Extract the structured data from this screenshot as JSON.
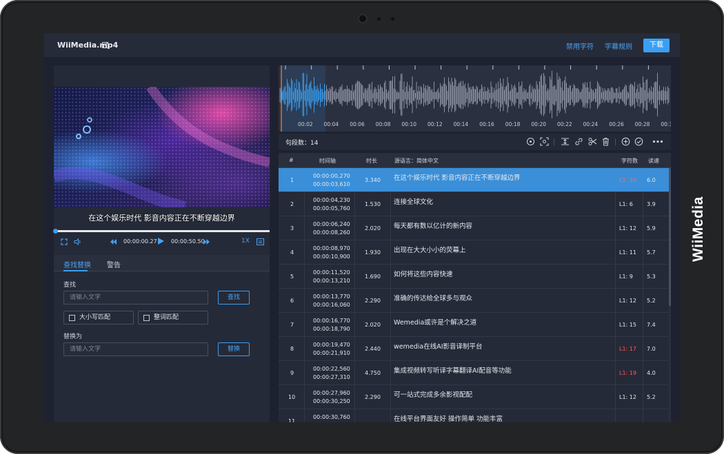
{
  "device": {
    "brand": "WiiMedia"
  },
  "header": {
    "file_name": "WiiMedia.mp4",
    "forbidden_chars_label": "禁用字符",
    "subtitle_rules_label": "字幕规则",
    "download_label": "下载"
  },
  "player": {
    "subtitle": "在这个娱乐时代 影音内容正在不断穿越边界",
    "current_time": "00:00:00.27",
    "total_time": "00:00:50.50",
    "speed": "1X",
    "progress": 0.005
  },
  "find_replace": {
    "tab_find_replace": "查找替换",
    "tab_warning": "警告",
    "find_label": "查找",
    "find_placeholder": "请输入文字",
    "find_button": "查找",
    "match_case_label": "大小写匹配",
    "whole_word_label": "整词匹配",
    "replace_label": "替换为",
    "replace_placeholder": "请输入文字",
    "replace_button": "替换"
  },
  "waveform": {
    "time_labels": [
      "00:02",
      "00:04",
      "00:06",
      "00:08",
      "00:10",
      "00:12",
      "00:14",
      "00:16",
      "00:18",
      "00:20",
      "00:22",
      "00:24",
      "00:26",
      "00:28",
      "00:3"
    ]
  },
  "toolbar": {
    "segment_count_label": "句段数：14",
    "icons": [
      "loop-icon",
      "screenshot-icon",
      "merge-icon",
      "link-icon",
      "scissors-icon",
      "trash-icon",
      "add-icon",
      "check-icon",
      "more-icon"
    ]
  },
  "table": {
    "headers": {
      "index": "#",
      "timeline": "时间轴",
      "duration": "时长",
      "source": "源语言：简体中文",
      "chars": "字符数",
      "speed": "读速"
    },
    "rows": [
      {
        "index": "1",
        "start": "00:00:00,270",
        "end": "00:00:03,610",
        "duration": "3.340",
        "text": "在这个娱乐时代 影音内容正在不断穿越边界",
        "chars": "L1: 20",
        "speed": "6.0",
        "over": true,
        "selected": true
      },
      {
        "index": "2",
        "start": "00:00:04,230",
        "end": "00:00:05,760",
        "duration": "1.530",
        "text": "连接全球文化",
        "chars": "L1: 6",
        "speed": "3.9",
        "over": false,
        "selected": false
      },
      {
        "index": "3",
        "start": "00:00:06,240",
        "end": "00:00:08,260",
        "duration": "2.020",
        "text": "每天都有数以亿计的新内容",
        "chars": "L1: 12",
        "speed": "5.9",
        "over": false,
        "selected": false
      },
      {
        "index": "4",
        "start": "00:00:08,970",
        "end": "00:00:10,900",
        "duration": "1.930",
        "text": "出现在大大小小的荧幕上",
        "chars": "L1: 11",
        "speed": "5.7",
        "over": false,
        "selected": false
      },
      {
        "index": "5",
        "start": "00:00:11,520",
        "end": "00:00:13,210",
        "duration": "1.690",
        "text": "如何将这些内容快速",
        "chars": "L1: 9",
        "speed": "5.3",
        "over": false,
        "selected": false
      },
      {
        "index": "6",
        "start": "00:00:13,770",
        "end": "00:00:16,060",
        "duration": "2.290",
        "text": "准确的传达给全球多与观众",
        "chars": "L1: 12",
        "speed": "5.2",
        "over": false,
        "selected": false
      },
      {
        "index": "7",
        "start": "00:00:16,770",
        "end": "00:00:18,790",
        "duration": "2.020",
        "text": "Wemedia或许是个解决之道",
        "chars": "L1: 15",
        "speed": "7.4",
        "over": false,
        "selected": false
      },
      {
        "index": "8",
        "start": "00:00:19,470",
        "end": "00:00:21,910",
        "duration": "2.440",
        "text": "wemedia在线AI影音译制平台",
        "chars": "L1: 17",
        "speed": "7.0",
        "over": true,
        "selected": false
      },
      {
        "index": "9",
        "start": "00:00:22,560",
        "end": "00:00:27,310",
        "duration": "4.750",
        "text": "集成视频转写听译字幕翻译AI配音等功能",
        "chars": "L1: 19",
        "speed": "4.0",
        "over": true,
        "selected": false
      },
      {
        "index": "10",
        "start": "00:00:27,960",
        "end": "00:00:30,250",
        "duration": "2.290",
        "text": "可一站式完成多余影视配配",
        "chars": "L1: 12",
        "speed": "5.2",
        "over": false,
        "selected": false
      },
      {
        "index": "11",
        "start": "00:00:30,760",
        "end": "",
        "duration": "",
        "text": "在线平台界面友好 操作简单 功能丰富",
        "chars": "",
        "speed": "",
        "over": true,
        "selected": false
      }
    ]
  },
  "colors": {
    "accent": "#3a9ff2",
    "selected_row": "#3a8fd8",
    "warning": "#ff5a5a",
    "background": "#1e2230"
  }
}
